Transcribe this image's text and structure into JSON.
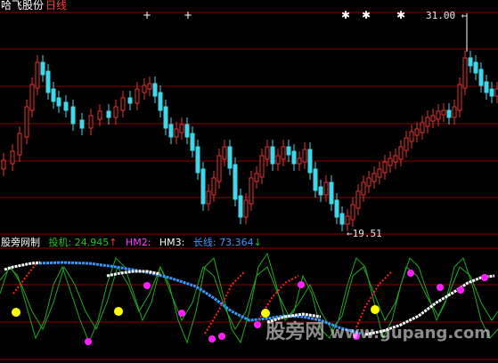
{
  "main_chart": {
    "stock_name": "哈飞股份",
    "period": "日线",
    "high_label": "31.00",
    "low_label": "19.51"
  },
  "indicator": {
    "name": "股旁网制",
    "items": [
      {
        "label": "投机:",
        "value": "24.945",
        "arrow": "↑",
        "color": "#22c322"
      },
      {
        "label": "HM2:",
        "value": "",
        "arrow": "",
        "color": "#ff40ff"
      },
      {
        "label": "HM3:",
        "value": "",
        "arrow": "",
        "color": "#ffffff"
      },
      {
        "label": "长线:",
        "value": "73.364",
        "arrow": "↓",
        "color": "#3399ff"
      }
    ]
  },
  "watermark": {
    "cn": "股旁网",
    "url": "www.gupang.com"
  },
  "colors": {
    "up": "#e83030",
    "down": "#40d8e8",
    "grid": "#8b0000",
    "green_line": "#22a822",
    "blue_line": "#3399ff",
    "white_line": "#ffffff",
    "red_line": "#ff2020",
    "yellow_dot": "#ffff00",
    "magenta_dot": "#ff20ff"
  }
}
